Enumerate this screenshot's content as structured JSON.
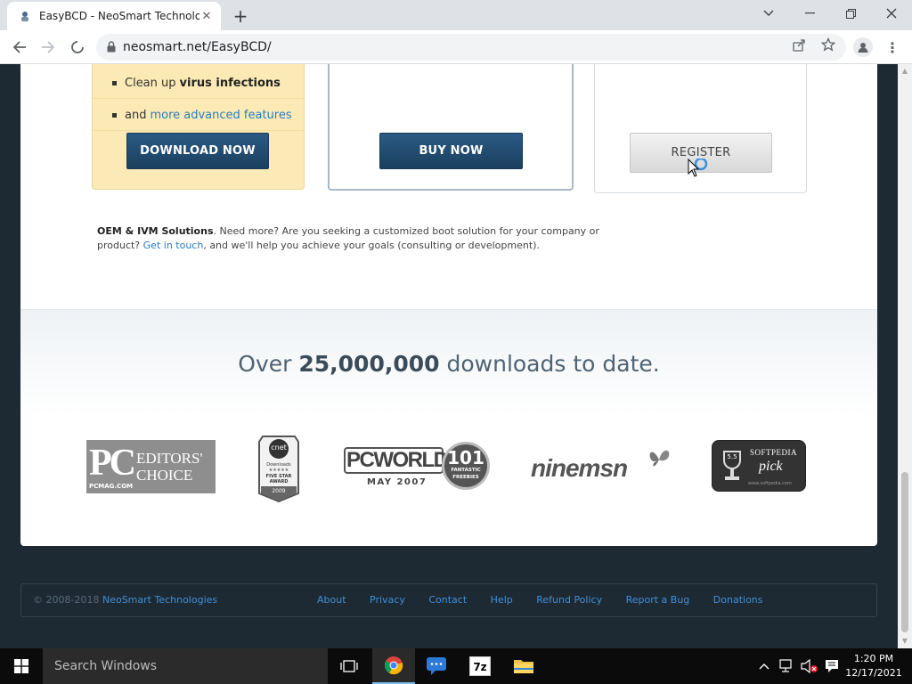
{
  "browser": {
    "tab_title": "EasyBCD - NeoSmart Technolo",
    "url": "neosmart.net/EasyBCD/"
  },
  "page": {
    "free_features": [
      {
        "pre": "Clean up",
        "bold": "virus infections"
      },
      {
        "pre": "and",
        "link": "more advanced features"
      }
    ],
    "download_button": "DOWNLOAD NOW",
    "buy_button": "BUY NOW",
    "register_button": "REGISTER",
    "oem": {
      "title": "OEM & IVM Solutions",
      "text1": ". Need more? Are you seeking a customized boot solution for your company or product?",
      "link": "Get in touch",
      "text2": ", and we'll help you achieve your goals (consulting or development)."
    },
    "downloads": {
      "prefix": "Over",
      "count": "25,000,000",
      "suffix": "downloads to date."
    },
    "awards": {
      "pcmag": {
        "big": "PC",
        "line1": "EDITORS'",
        "line2": "CHOICE",
        "sub": "PCMAG.COM"
      },
      "cnet": {
        "logo": "cnet",
        "line1": "Downloads",
        "stars": "★★★★★",
        "line2": "FIVE STAR",
        "line3": "AWARD",
        "year": "2009"
      },
      "pcworld": {
        "name": "PCWORLD",
        "date": "MAY 2007",
        "num": "101",
        "sub1": "FANTASTIC",
        "sub2": "FREEBIES"
      },
      "ninemsn": {
        "name": "ninemsn"
      },
      "softpedia": {
        "name": "SOFTPEDIA",
        "pick": "pick",
        "badge": "5.5",
        "site": "www.softpedia.com"
      }
    }
  },
  "footer": {
    "copyright": "© 2008-2018",
    "brand": "NeoSmart Technologies",
    "links": [
      "About",
      "Privacy",
      "Contact",
      "Help",
      "Refund Policy",
      "Report a Bug",
      "Donations"
    ]
  },
  "taskbar": {
    "search_placeholder": "Search Windows",
    "time": "1:20 PM",
    "date": "12/17/2021"
  }
}
